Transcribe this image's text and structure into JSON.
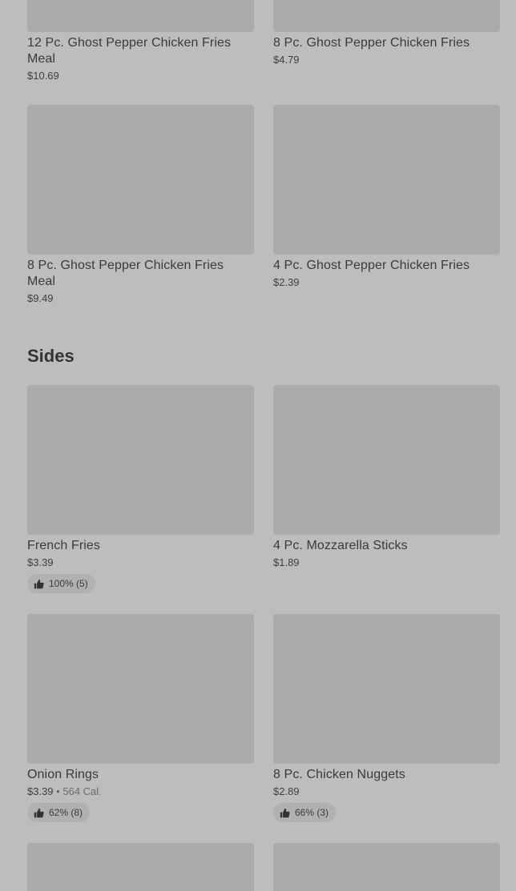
{
  "sections": {
    "ghost_pepper": {
      "items": [
        {
          "name": "12 Pc. Ghost Pepper Chicken Fries Meal",
          "price": "$10.69"
        },
        {
          "name": "8 Pc. Ghost Pepper Chicken Fries",
          "price": "$4.79"
        },
        {
          "name": "8 Pc. Ghost Pepper Chicken Fries Meal",
          "price": "$9.49"
        },
        {
          "name": "4 Pc. Ghost Pepper Chicken Fries",
          "price": "$2.39"
        }
      ]
    },
    "sides": {
      "title": "Sides",
      "items": [
        {
          "name": "French Fries",
          "price": "$3.39",
          "rating": "100% (5)"
        },
        {
          "name": "4 Pc. Mozzarella Sticks",
          "price": "$1.89"
        },
        {
          "name": "Onion Rings",
          "price": "$3.39",
          "separator": "•",
          "calories": "564 Cal.",
          "rating": "62% (8)"
        },
        {
          "name": "8 Pc. Chicken Nuggets",
          "price": "$2.89",
          "rating": "66% (3)"
        }
      ]
    }
  },
  "icons": {
    "rating": "thumbs-up-icon"
  },
  "colors": {
    "background": "#bdbdbd",
    "placeholder": "#ababab",
    "badge": "#b1b1b1"
  }
}
